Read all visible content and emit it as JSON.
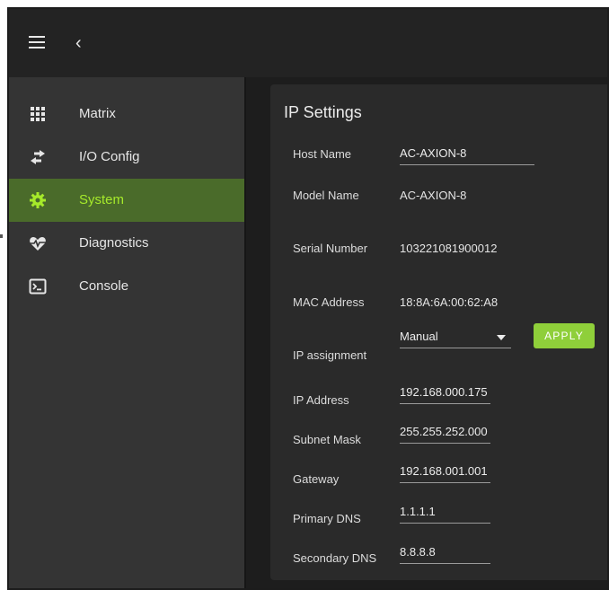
{
  "topbar": {
    "menu_icon": "hamburger-menu-icon",
    "back_icon": "chevron-left-icon"
  },
  "sidebar": {
    "items": [
      {
        "label": "Matrix",
        "icon": "grid-icon"
      },
      {
        "label": "I/O Config",
        "icon": "swap-arrows-icon"
      },
      {
        "label": "System",
        "icon": "gear-icon",
        "active": true
      },
      {
        "label": "Diagnostics",
        "icon": "heartbeat-icon"
      },
      {
        "label": "Console",
        "icon": "terminal-icon"
      }
    ]
  },
  "ip_settings": {
    "title": "IP Settings",
    "host_name": {
      "label": "Host Name",
      "value": "AC-AXION-8"
    },
    "model_name": {
      "label": "Model Name",
      "value": "AC-AXION-8"
    },
    "serial_number": {
      "label": "Serial Number",
      "value": "103221081900012"
    },
    "mac_address": {
      "label": "MAC Address",
      "value": "18:8A:6A:00:62:A8"
    },
    "ip_assignment": {
      "label": "IP assignment",
      "value": "Manual"
    },
    "apply_label": "APPLY",
    "ip_address": {
      "label": "IP Address",
      "value": "192.168.000.175"
    },
    "subnet_mask": {
      "label": "Subnet Mask",
      "value": "255.255.252.000"
    },
    "gateway": {
      "label": "Gateway",
      "value": "192.168.001.001"
    },
    "primary_dns": {
      "label": "Primary DNS",
      "value": "1.1.1.1"
    },
    "secondary_dns": {
      "label": "Secondary DNS",
      "value": "8.8.8.8"
    }
  },
  "colors": {
    "active_nav_bg": "#4a6b2a",
    "active_nav_text": "#a6ea2a",
    "apply_button": "#8fcf3a",
    "sidebar_bg": "#343434",
    "card_bg": "#2a2a2a"
  }
}
